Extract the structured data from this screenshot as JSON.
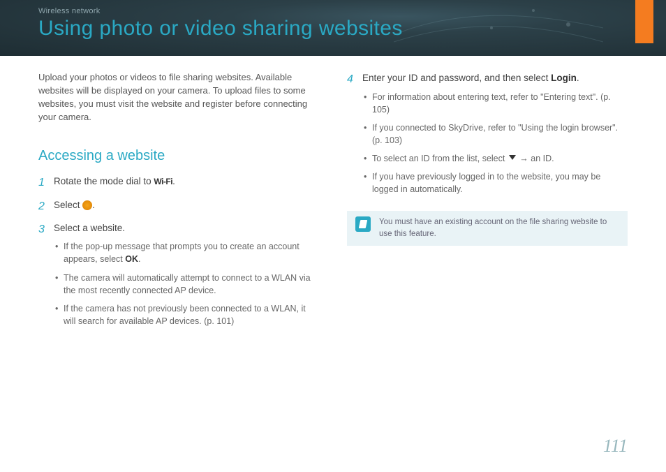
{
  "header": {
    "breadcrumb": "Wireless network",
    "title": "Using photo or video sharing websites"
  },
  "intro": "Upload your photos or videos to file sharing websites. Available websites will be displayed on your camera. To upload files to some websites, you must visit the website and register before connecting your camera.",
  "section": {
    "title": "Accessing a website"
  },
  "steps": {
    "s1": {
      "num": "1",
      "text_a": "Rotate the mode dial to ",
      "icon_label": "Wi-Fi",
      "text_b": "."
    },
    "s2": {
      "num": "2",
      "text_a": "Select ",
      "text_b": "."
    },
    "s3": {
      "num": "3",
      "text": "Select a website.",
      "bullets": {
        "b1a": "If the pop-up message that prompts you to create an account appears, select ",
        "b1_bold": "OK",
        "b1b": ".",
        "b2": "The camera will automatically attempt to connect to a WLAN via the most recently connected AP device.",
        "b3": "If the camera has not previously been connected to a WLAN, it will search for available AP devices. (p. 101)"
      }
    },
    "s4": {
      "num": "4",
      "text_a": "Enter your ID and password, and then select ",
      "text_bold": "Login",
      "text_b": ".",
      "bullets": {
        "b1": "For information about entering text, refer to \"Entering text\". (p. 105)",
        "b2": "If you connected to SkyDrive, refer to \"Using the login browser\". (p. 103)",
        "b3a": "To select an ID from the list, select ",
        "b3b": " → an ID.",
        "b4": "If you have previously logged in to the website, you may be logged in automatically."
      }
    }
  },
  "note": "You must have an existing account on the file sharing website to use this feature.",
  "page_number": "111"
}
